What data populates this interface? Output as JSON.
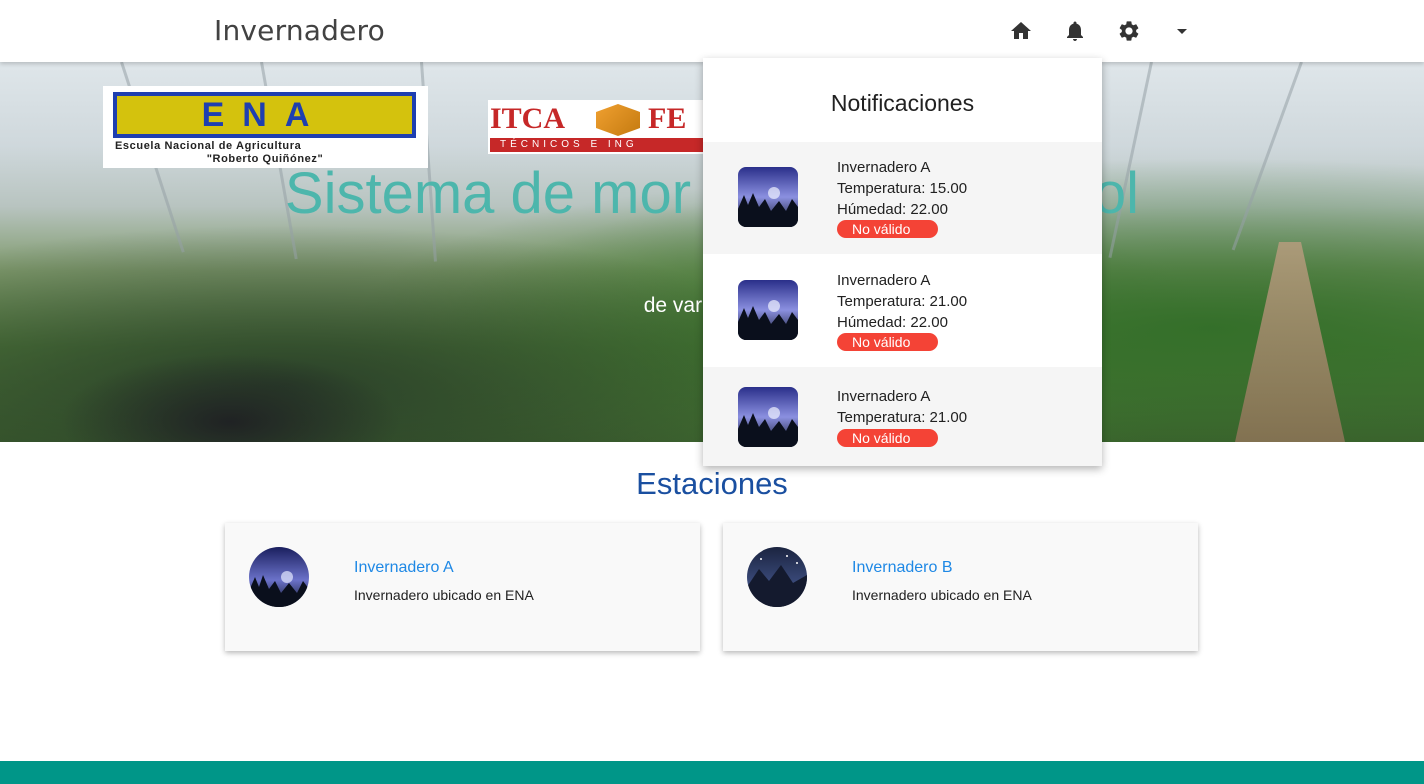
{
  "navbar": {
    "brand": "Invernadero",
    "icons": [
      "home-icon",
      "bell-icon",
      "gear-icon",
      "caret-down-icon"
    ]
  },
  "hero": {
    "logo_ena": {
      "letters": "ENA",
      "line1": "Escuela Nacional de Agricultura",
      "line2": "\"Roberto Quiñónez\""
    },
    "logo_itca": {
      "word1": "ITCA",
      "word2": "FE",
      "tagline": "TÉCNICOS E ING"
    },
    "title": "Sistema de mor                         ol",
    "subtitle": "de variables m"
  },
  "section": {
    "title": "Estaciones"
  },
  "stations": [
    {
      "name": "Invernadero A",
      "description": "Invernadero ubicado en ENA"
    },
    {
      "name": "Invernadero B",
      "description": "Invernadero ubicado en ENA"
    }
  ],
  "notifications": {
    "title": "Notificaciones",
    "items": [
      {
        "name": "Invernadero A",
        "temperature": "Temperatura: 15.00",
        "humidity": "Húmedad: 22.00",
        "status": "No válido"
      },
      {
        "name": "Invernadero A",
        "temperature": "Temperatura: 21.00",
        "humidity": "Húmedad: 22.00",
        "status": "No válido"
      },
      {
        "name": "Invernadero A",
        "temperature": "Temperatura: 21.00",
        "status": "No válido"
      }
    ]
  },
  "colors": {
    "accent_teal": "#009688",
    "hero_title": "#4db6ac",
    "section_title": "#1a4fa0",
    "link_blue": "#1e88e5",
    "badge_red": "#f44336"
  }
}
